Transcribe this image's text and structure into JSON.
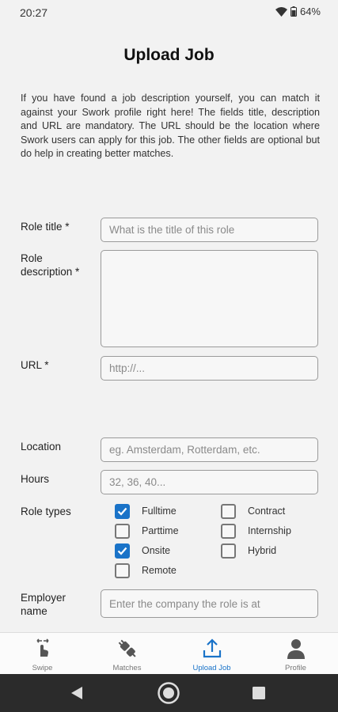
{
  "status": {
    "time": "20:27",
    "battery": "64%"
  },
  "page": {
    "title": "Upload Job",
    "intro": "If you have found a job description yourself, you can match it against your Swork profile right here! The fields title, description and URL are mandatory. The URL should be the location where Swork users can apply for this job. The other fields are optional but do help in creating better matches."
  },
  "form": {
    "role_title": {
      "label": "Role title *",
      "placeholder": "What is the title of this role",
      "value": ""
    },
    "role_description": {
      "label": "Role\ndescription *",
      "placeholder": "",
      "value": ""
    },
    "url": {
      "label": "URL *",
      "placeholder": "http://...",
      "value": ""
    },
    "location": {
      "label": "Location",
      "placeholder": "eg. Amsterdam, Rotterdam, etc.",
      "value": ""
    },
    "hours": {
      "label": "Hours",
      "placeholder": "32, 36, 40...",
      "value": ""
    },
    "role_types": {
      "label": "Role types",
      "options": [
        {
          "label": "Fulltime",
          "checked": true
        },
        {
          "label": "Contract",
          "checked": false
        },
        {
          "label": "Parttime",
          "checked": false
        },
        {
          "label": "Internship",
          "checked": false
        },
        {
          "label": "Onsite",
          "checked": true
        },
        {
          "label": "Hybrid",
          "checked": false
        },
        {
          "label": "Remote",
          "checked": false
        }
      ]
    },
    "employer_name": {
      "label": "Employer\nname",
      "placeholder": "Enter the company the role is at",
      "value": ""
    }
  },
  "bottom_nav": {
    "active": "upload-job",
    "items": [
      {
        "label": "Swipe",
        "icon": "swipe-hand-icon"
      },
      {
        "label": "Matches",
        "icon": "plug-icon"
      },
      {
        "label": "Upload Job",
        "icon": "upload-icon"
      },
      {
        "label": "Profile",
        "icon": "person-icon"
      }
    ]
  },
  "colors": {
    "accent": "#1a73c8",
    "background": "#f2f2f2",
    "system_nav": "#2b2b2b"
  }
}
